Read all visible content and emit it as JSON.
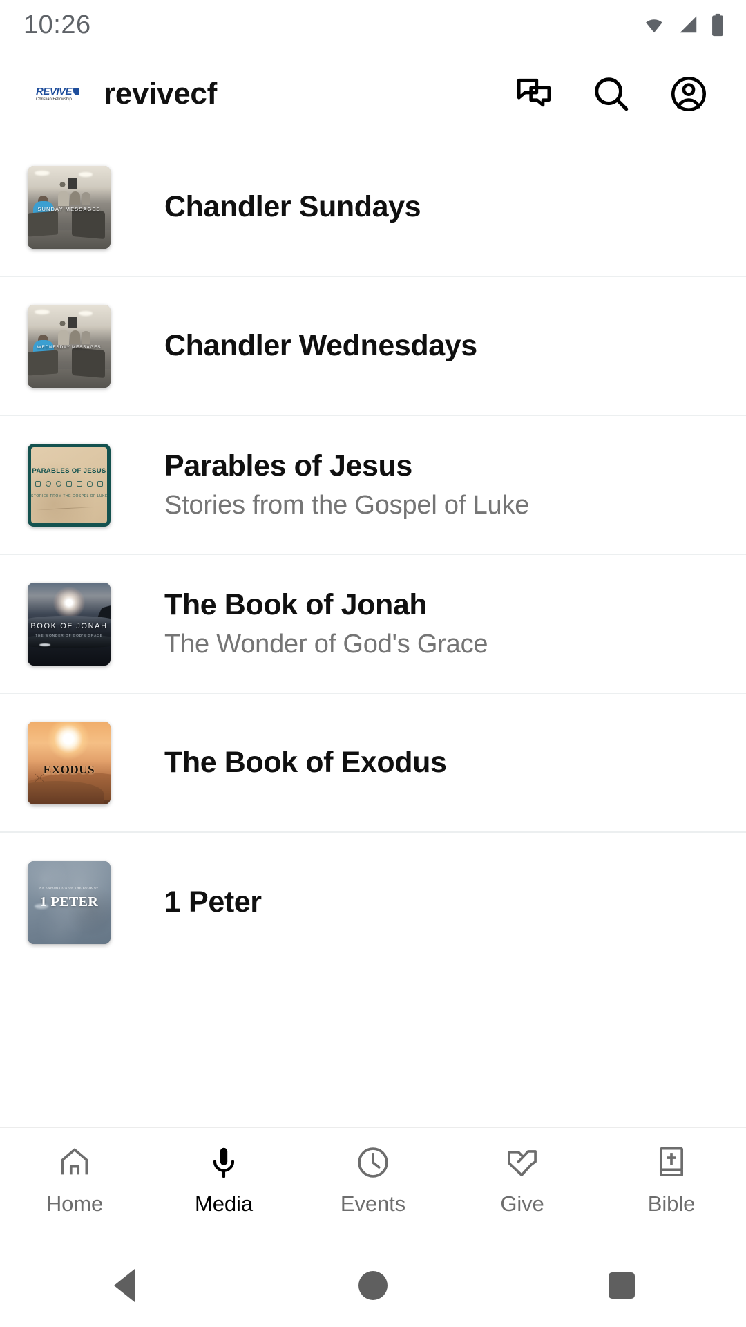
{
  "status_bar": {
    "time": "10:26",
    "icons": [
      "wifi-icon",
      "cellular-signal-icon",
      "battery-icon"
    ]
  },
  "app_bar": {
    "logo": {
      "name": "revive-christian-fellowship-logo",
      "word": "REVIVE",
      "subtitle": "Christian Fellowship",
      "color": "#1e4d9b"
    },
    "title": "revivecf",
    "actions": [
      {
        "name": "messages-icon",
        "label": "Messages"
      },
      {
        "name": "search-icon",
        "label": "Search"
      },
      {
        "name": "account-icon",
        "label": "Account"
      }
    ]
  },
  "media_list": {
    "items": [
      {
        "title": "Chandler Sundays",
        "subtitle": "",
        "art": "room",
        "art_caption": "SUNDAY MESSAGES"
      },
      {
        "title": "Chandler Wednesdays",
        "subtitle": "",
        "art": "room",
        "art_caption": "WEDNESDAY MESSAGES"
      },
      {
        "title": "Parables of Jesus",
        "subtitle": "Stories from the Gospel of Luke",
        "art": "parables",
        "art_caption": "PARABLES OF JESUS",
        "art_subcaption": "STORIES FROM THE GOSPEL OF LUKE"
      },
      {
        "title": "The Book of Jonah",
        "subtitle": "The Wonder of God's Grace",
        "art": "jonah",
        "art_caption": "BOOK OF JONAH",
        "art_subcaption": "THE WONDER OF GOD'S GRACE"
      },
      {
        "title": "The Book of Exodus",
        "subtitle": "",
        "art": "exodus",
        "art_caption": "EXODUS"
      },
      {
        "title": "1 Peter",
        "subtitle": "",
        "art": "peter",
        "art_caption": "1 PETER",
        "art_eyebrow": "AN EXPOSITION OF THE BOOK OF"
      }
    ]
  },
  "tab_bar": {
    "active": "Media",
    "tabs": [
      {
        "label": "Home",
        "icon": "home-icon",
        "active": false
      },
      {
        "label": "Media",
        "icon": "microphone-icon",
        "active": true
      },
      {
        "label": "Events",
        "icon": "clock-icon",
        "active": false
      },
      {
        "label": "Give",
        "icon": "giving-hands-icon",
        "active": false
      },
      {
        "label": "Bible",
        "icon": "bible-icon",
        "active": false
      }
    ]
  },
  "system_nav": {
    "buttons": [
      {
        "name": "back-button",
        "icon": "triangle-left-icon"
      },
      {
        "name": "home-button",
        "icon": "circle-icon"
      },
      {
        "name": "recents-button",
        "icon": "square-icon"
      }
    ]
  },
  "colors": {
    "accent": "#1e4d9b",
    "title_text": "#101010",
    "subtitle_text": "#757575",
    "divider": "#eceff0",
    "inactive_tab": "#6d6d6d",
    "active_tab": "#000000"
  }
}
